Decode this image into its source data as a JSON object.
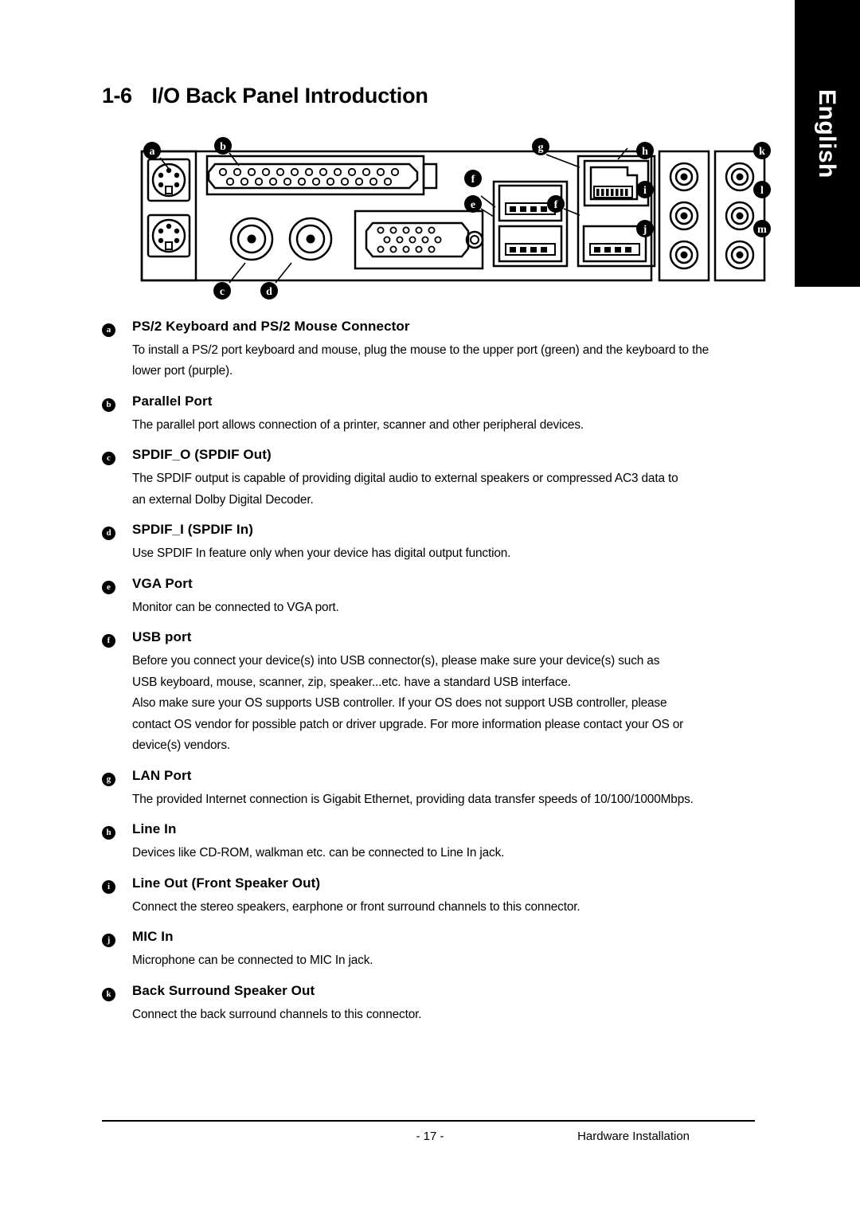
{
  "lang_tab": {
    "label": "English"
  },
  "header": {
    "section_number": "1-6",
    "section_title": "I/O Back Panel Introduction"
  },
  "diagram": {
    "name": "io-back-panel-diagram",
    "callouts": [
      "a",
      "b",
      "c",
      "d",
      "e",
      "f",
      "g",
      "h",
      "i",
      "j",
      "k",
      "l",
      "m"
    ]
  },
  "items": [
    {
      "marker": "a",
      "title": "PS/2 Keyboard and PS/2 Mouse Connector",
      "lines": [
        "To install a PS/2 port keyboard and mouse, plug the mouse to the upper port (green) and the keyboard to the",
        "lower port (purple)."
      ]
    },
    {
      "marker": "b",
      "title": "Parallel Port",
      "lines": [
        "The parallel port allows connection of a printer, scanner and other peripheral devices."
      ]
    },
    {
      "marker": "c",
      "title": "SPDIF_O (SPDIF Out)",
      "lines": [
        "The SPDIF output is capable of providing digital audio to external speakers or compressed AC3 data to",
        "an external Dolby Digital Decoder."
      ]
    },
    {
      "marker": "d",
      "title": "SPDIF_I (SPDIF In)",
      "lines": [
        "Use SPDIF In  feature only when your device has digital output function."
      ]
    },
    {
      "marker": "e",
      "title": "VGA Port",
      "lines": [
        "Monitor can be connected to VGA port."
      ]
    },
    {
      "marker": "f",
      "title": "USB port",
      "lines": [
        "Before you connect your device(s) into USB connector(s), please make sure your device(s) such as",
        "USB keyboard, mouse, scanner, zip, speaker...etc. have a standard USB interface.",
        "Also make sure your OS supports USB controller. If your OS does not support USB controller, please",
        "contact OS vendor for possible patch or driver upgrade. For more information please contact your OS or",
        "device(s) vendors."
      ]
    },
    {
      "marker": "g",
      "title": "LAN Port",
      "lines": [
        "The provided Internet connection is Gigabit Ethernet, providing data transfer speeds of 10/100/1000Mbps."
      ]
    },
    {
      "marker": "h",
      "title": "Line In",
      "lines": [
        "Devices like CD-ROM, walkman etc. can be connected to Line In jack."
      ]
    },
    {
      "marker": "i",
      "title": "Line Out (Front Speaker Out)",
      "lines": [
        "Connect the stereo speakers, earphone or front surround channels to this connector."
      ]
    },
    {
      "marker": "j",
      "title": "MIC In",
      "lines": [
        "Microphone can be connected to MIC In jack."
      ]
    },
    {
      "marker": "k",
      "title": "Back Surround Speaker Out",
      "lines": [
        "Connect the back surround channels to this connector."
      ]
    }
  ],
  "footer": {
    "page_number": "- 17 -",
    "section_label": "Hardware Installation"
  }
}
